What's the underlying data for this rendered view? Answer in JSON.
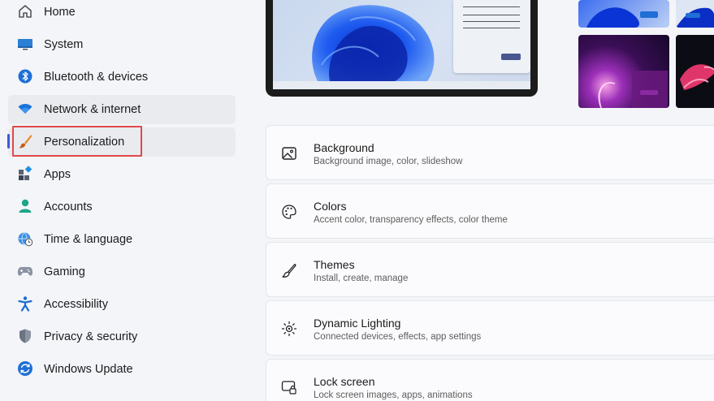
{
  "sidebar": {
    "items": [
      {
        "label": "Home",
        "icon": "home-icon"
      },
      {
        "label": "System",
        "icon": "monitor-icon"
      },
      {
        "label": "Bluetooth & devices",
        "icon": "bluetooth-icon"
      },
      {
        "label": "Network & internet",
        "icon": "wifi-icon"
      },
      {
        "label": "Personalization",
        "icon": "paintbrush-icon"
      },
      {
        "label": "Apps",
        "icon": "apps-icon"
      },
      {
        "label": "Accounts",
        "icon": "person-icon"
      },
      {
        "label": "Time & language",
        "icon": "globe-clock-icon"
      },
      {
        "label": "Gaming",
        "icon": "gamepad-icon"
      },
      {
        "label": "Accessibility",
        "icon": "accessibility-icon"
      },
      {
        "label": "Privacy & security",
        "icon": "shield-icon"
      },
      {
        "label": "Windows Update",
        "icon": "update-icon"
      }
    ],
    "selected_index": 4,
    "hover_index": 3
  },
  "settings": [
    {
      "title": "Background",
      "desc": "Background image, color, slideshow",
      "icon": "image-icon"
    },
    {
      "title": "Colors",
      "desc": "Accent color, transparency effects, color theme",
      "icon": "palette-icon"
    },
    {
      "title": "Themes",
      "desc": "Install, create, manage",
      "icon": "brush-icon"
    },
    {
      "title": "Dynamic Lighting",
      "desc": "Connected devices, effects, app settings",
      "icon": "lighting-icon"
    },
    {
      "title": "Lock screen",
      "desc": "Lock screen images, apps, animations",
      "icon": "lock-screen-icon"
    }
  ],
  "colors": {
    "accent": "#3c5bd6",
    "highlight": "#e0494a"
  }
}
